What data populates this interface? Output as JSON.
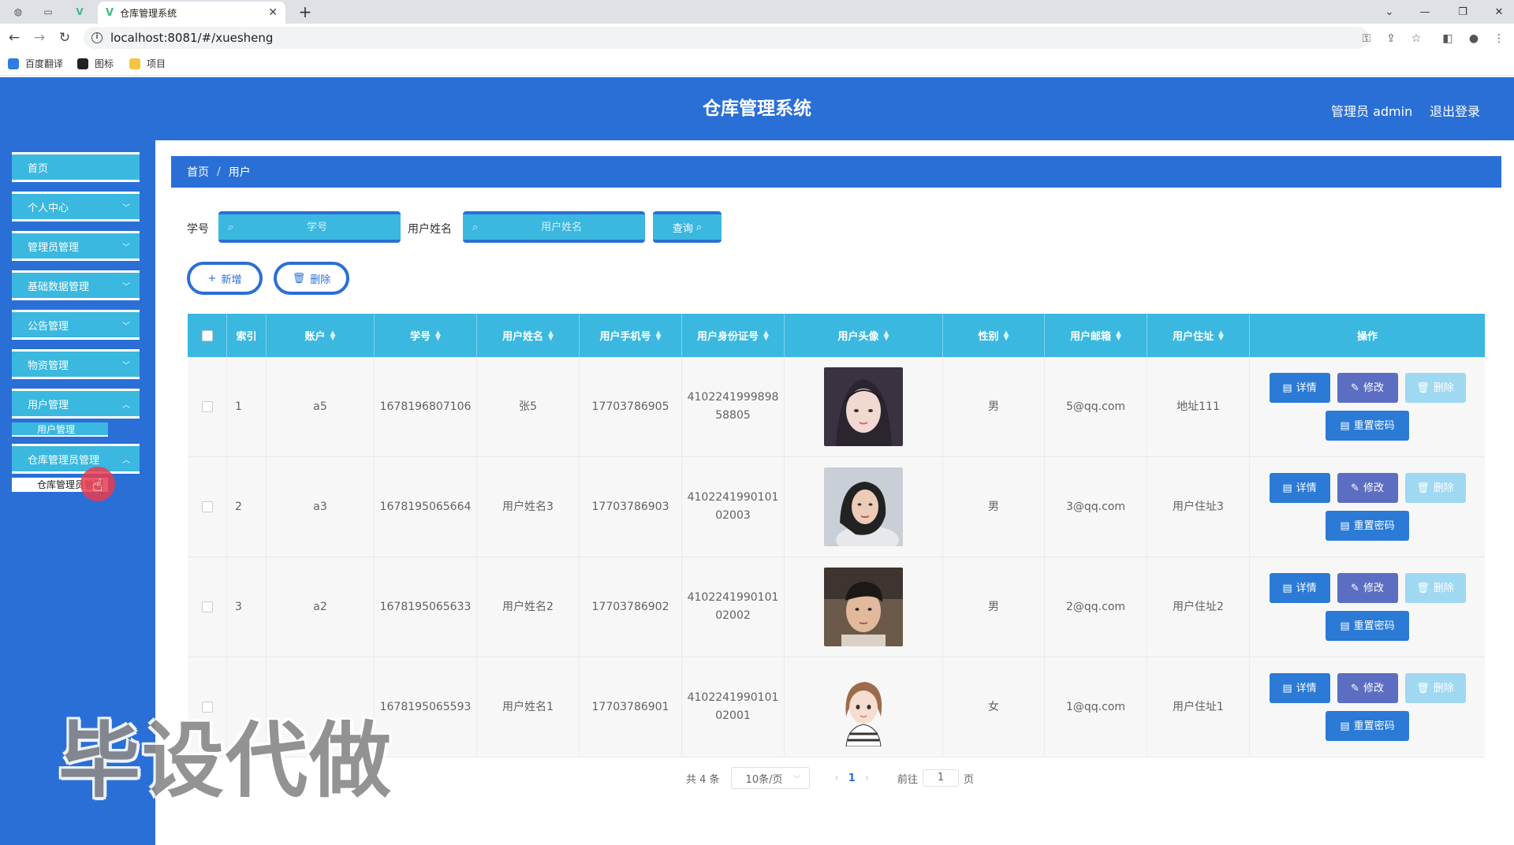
{
  "browser": {
    "tab_title": "仓库管理系统",
    "url": "localhost:8081/#/xuesheng",
    "bookmarks": [
      "百度翻译",
      "图标",
      "项目"
    ]
  },
  "header": {
    "title": "仓库管理系统",
    "admin_label": "管理员 admin",
    "logout_label": "退出登录",
    "color": "#2a6fd6"
  },
  "sidebar": {
    "items": [
      {
        "label": "首页"
      },
      {
        "label": "个人中心"
      },
      {
        "label": "管理员管理"
      },
      {
        "label": "基础数据管理"
      },
      {
        "label": "公告管理"
      },
      {
        "label": "物资管理"
      },
      {
        "label": "用户管理"
      },
      {
        "label": "用户管理",
        "sub": true
      },
      {
        "label": "仓库管理员管理"
      },
      {
        "label": "仓库管理员管理",
        "sub": true
      }
    ],
    "accent": "#3ab8e0"
  },
  "breadcrumb": {
    "home": "首页",
    "sep": "/",
    "current": "用户"
  },
  "search": {
    "field1_label": "学号",
    "field1_placeholder": "学号",
    "field2_label": "用户姓名",
    "field2_placeholder": "用户姓名",
    "query_label": "查询"
  },
  "actions": {
    "add_label": "新增",
    "delete_label": "删除"
  },
  "table": {
    "headers": [
      "索引",
      "账户",
      "学号",
      "用户姓名",
      "用户手机号",
      "用户身份证号",
      "用户头像",
      "性别",
      "用户邮箱",
      "用户住址",
      "操作"
    ],
    "rows": [
      {
        "index": "1",
        "account": "a5",
        "student_no": "1678196807106",
        "name": "张5",
        "phone": "17703786905",
        "id_line1": "4102241999898",
        "id_line2": "58805",
        "avatar": "avatar-girl-photo",
        "gender": "男",
        "email": "5@qq.com",
        "address": "地址111"
      },
      {
        "index": "2",
        "account": "a3",
        "student_no": "1678195065664",
        "name": "用户姓名3",
        "phone": "17703786903",
        "id_line1": "4102241990101",
        "id_line2": "02003",
        "avatar": "avatar-woman-photo",
        "gender": "男",
        "email": "3@qq.com",
        "address": "用户住址3"
      },
      {
        "index": "3",
        "account": "a2",
        "student_no": "1678195065633",
        "name": "用户姓名2",
        "phone": "17703786902",
        "id_line1": "4102241990101",
        "id_line2": "02002",
        "avatar": "avatar-boy-photo",
        "gender": "男",
        "email": "2@qq.com",
        "address": "用户住址2"
      },
      {
        "index": "",
        "account": "",
        "student_no": "1678195065593",
        "name": "用户姓名1",
        "phone": "17703786901",
        "id_line1": "4102241990101",
        "id_line2": "02001",
        "avatar": "avatar-cartoon-girl",
        "gender": "女",
        "email": "1@qq.com",
        "address": "用户住址1"
      }
    ],
    "op_labels": {
      "detail": "详情",
      "edit": "修改",
      "delete": "删除",
      "reset": "重置密码"
    }
  },
  "pager": {
    "total": "共 4 条",
    "page_size": "10条/页",
    "current_page": "1",
    "goto_label": "前往",
    "goto_value": "1",
    "page_suffix": "页"
  },
  "watermark": "毕设代做"
}
